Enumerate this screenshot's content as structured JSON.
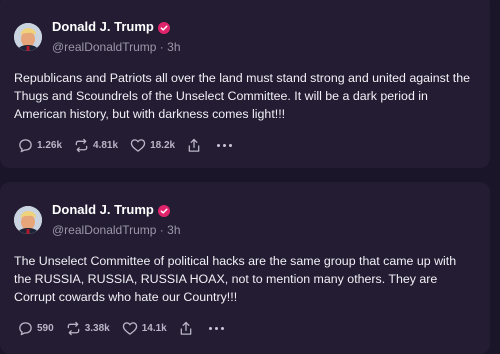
{
  "posts": [
    {
      "author": {
        "name": "Donald J. Trump",
        "handle": "@realDonaldTrump",
        "time": "3h"
      },
      "text": "Republicans and Patriots all over the land must stand strong and united against the Thugs and Scoundrels of the Unselect Committee. It will be a dark period in American history, but with darkness comes light!!!",
      "stats": {
        "replies": "1.26k",
        "reposts": "4.81k",
        "likes": "18.2k"
      }
    },
    {
      "author": {
        "name": "Donald J. Trump",
        "handle": "@realDonaldTrump",
        "time": "3h"
      },
      "text": "The Unselect Committee of political hacks are the same group that came up with the RUSSIA, RUSSIA, RUSSIA HOAX, not to mention many others. They are Corrupt cowards who hate our Country!!!",
      "stats": {
        "replies": "590",
        "reposts": "3.38k",
        "likes": "14.1k"
      }
    }
  ],
  "icons": {
    "verified": "verified-badge-icon",
    "reply": "reply-bubble-icon",
    "repost": "repost-icon",
    "like": "heart-icon",
    "share": "share-icon",
    "more": "more-dots-icon"
  },
  "colors": {
    "background": "#1b1529",
    "card": "#231c33",
    "verified": "#e0246c",
    "muted": "#9b97a8"
  }
}
